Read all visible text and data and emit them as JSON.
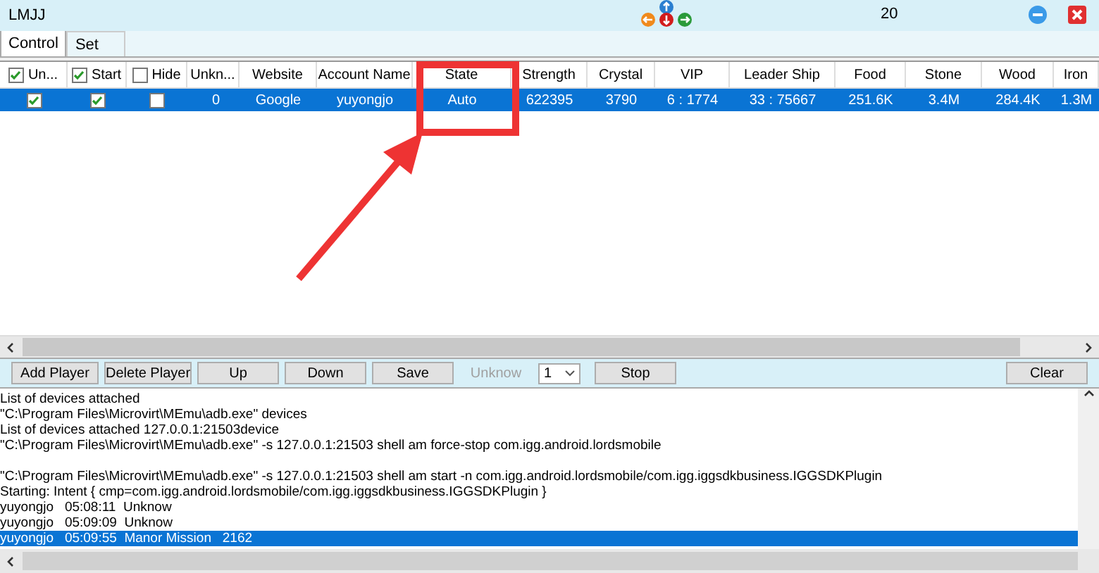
{
  "window": {
    "title": "LMJJ",
    "counter": "20"
  },
  "tabs": [
    {
      "label": "Control",
      "selected": true
    },
    {
      "label": "Set",
      "selected": false
    }
  ],
  "table": {
    "columns": [
      {
        "label": "Un...",
        "kind": "check",
        "checked": true
      },
      {
        "label": "Start",
        "kind": "check",
        "checked": true
      },
      {
        "label": "Hide",
        "kind": "check",
        "checked": false
      },
      {
        "label": "Unkn...",
        "kind": "text"
      },
      {
        "label": "Website",
        "kind": "text"
      },
      {
        "label": "Account Name",
        "kind": "text"
      },
      {
        "label": "State",
        "kind": "text"
      },
      {
        "label": "Strength",
        "kind": "text"
      },
      {
        "label": "Crystal",
        "kind": "text"
      },
      {
        "label": "VIP",
        "kind": "text"
      },
      {
        "label": "Leader Ship",
        "kind": "text"
      },
      {
        "label": "Food",
        "kind": "text"
      },
      {
        "label": "Stone",
        "kind": "text"
      },
      {
        "label": "Wood",
        "kind": "text"
      },
      {
        "label": "Iron",
        "kind": "text"
      }
    ],
    "rows": [
      {
        "selected": true,
        "cells": [
          {
            "kind": "check",
            "checked": true
          },
          {
            "kind": "check",
            "checked": true
          },
          {
            "kind": "check",
            "checked": false
          },
          {
            "kind": "text",
            "text": "0"
          },
          {
            "kind": "text",
            "text": "Google"
          },
          {
            "kind": "text",
            "text": "yuyongjo"
          },
          {
            "kind": "text",
            "text": "Auto"
          },
          {
            "kind": "text",
            "text": "622395"
          },
          {
            "kind": "text",
            "text": "3790"
          },
          {
            "kind": "text",
            "text": "6 : 1774"
          },
          {
            "kind": "text",
            "text": "33 : 75667"
          },
          {
            "kind": "text",
            "text": "251.6K"
          },
          {
            "kind": "text",
            "text": "3.4M"
          },
          {
            "kind": "text",
            "text": "284.4K"
          },
          {
            "kind": "text",
            "text": "1.3M"
          }
        ]
      }
    ]
  },
  "toolbar": [
    {
      "kind": "button",
      "label": "Add Player"
    },
    {
      "kind": "button",
      "label": "Delete Player"
    },
    {
      "kind": "button",
      "label": "Up"
    },
    {
      "kind": "button",
      "label": "Down"
    },
    {
      "kind": "button",
      "label": "Save"
    },
    {
      "kind": "label",
      "label": "Unknow",
      "disabled": true
    },
    {
      "kind": "select",
      "label": "1"
    },
    {
      "kind": "button",
      "label": "Stop"
    },
    {
      "kind": "spacer"
    },
    {
      "kind": "button",
      "label": "Clear"
    }
  ],
  "log": [
    {
      "text": "List of devices attached",
      "selected": false
    },
    {
      "text": "\"C:\\Program Files\\Microvirt\\MEmu\\adb.exe\" devices",
      "selected": false
    },
    {
      "text": "List of devices attached 127.0.0.1:21503device",
      "selected": false
    },
    {
      "text": "\"C:\\Program Files\\Microvirt\\MEmu\\adb.exe\" -s 127.0.0.1:21503 shell am force-stop com.igg.android.lordsmobile",
      "selected": false
    },
    {
      "selected": false
    },
    {
      "text": "\"C:\\Program Files\\Microvirt\\MEmu\\adb.exe\" -s 127.0.0.1:21503 shell am start -n com.igg.android.lordsmobile/com.igg.iggsdkbusiness.IGGSDKPlugin",
      "selected": false
    },
    {
      "text": "Starting: Intent { cmp=com.igg.android.lordsmobile/com.igg.iggsdkbusiness.IGGSDKPlugin }",
      "selected": false
    },
    {
      "text": "yuyongjo   05:08:11  Unknow",
      "selected": false
    },
    {
      "text": "yuyongjo   05:09:09  Unknow",
      "selected": false
    },
    {
      "text": "yuyongjo   05:09:55  Manor Mission   2162",
      "selected": true
    }
  ]
}
